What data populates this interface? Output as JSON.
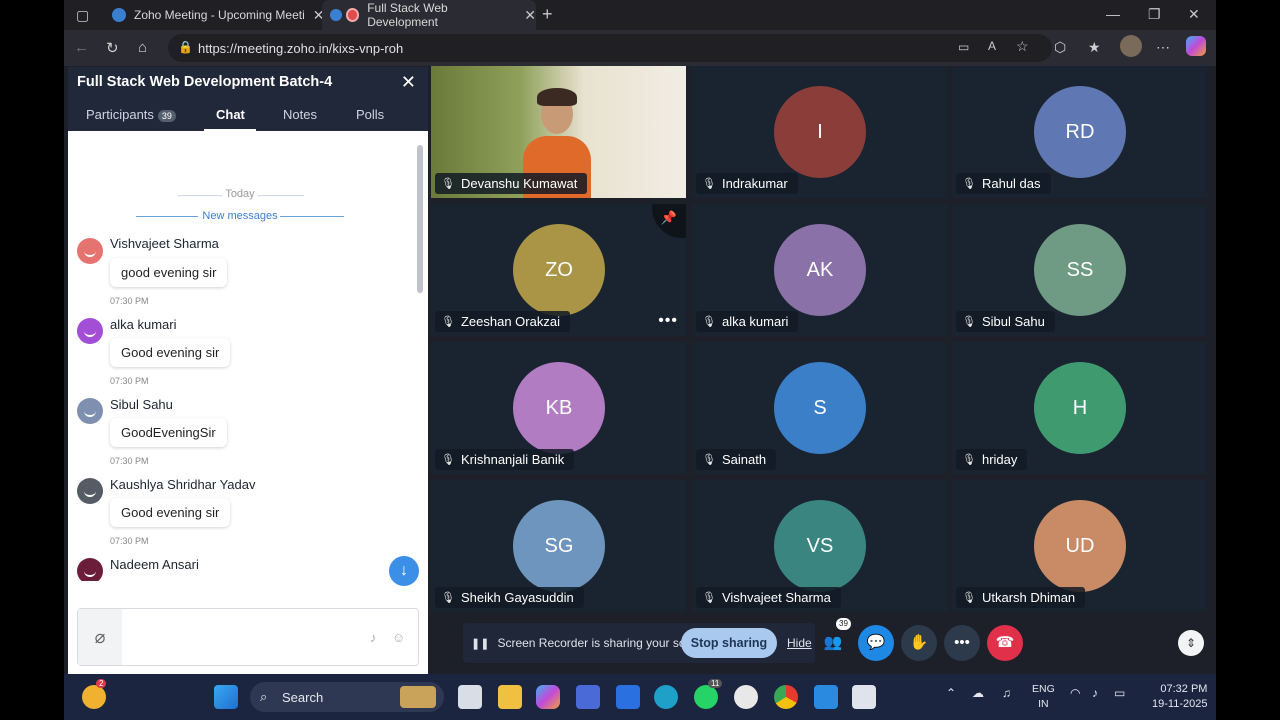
{
  "browser": {
    "tabs": [
      {
        "label": "Zoho Meeting - Upcoming Meeti"
      },
      {
        "label": "Full Stack Web Development"
      }
    ],
    "url": "https://meeting.zoho.in/kixs-vnp-roh"
  },
  "panel": {
    "title": "Full Stack Web Development Batch-4",
    "tabs": {
      "participants": "Participants",
      "participants_count": "39",
      "chat": "Chat",
      "notes": "Notes",
      "polls": "Polls"
    },
    "separator_today": "Today",
    "separator_new": "New messages",
    "messages": [
      {
        "name": "Vishvajeet Sharma",
        "text": "good evening sir",
        "time": "07:30 PM",
        "color": "#e5736f"
      },
      {
        "name": "alka kumari",
        "text": "Good evening sir",
        "time": "07:30 PM",
        "color": "#a24fd6"
      },
      {
        "name": "Sibul Sahu",
        "text": "GoodEveningSir",
        "time": "07:30 PM",
        "color": "#7f8fb0"
      },
      {
        "name": "Kaushlya Shridhar Yadav",
        "text": "Good evening sir",
        "time": "07:30 PM",
        "color": "#555c66"
      },
      {
        "name": "Nadeem Ansari",
        "color": "#6a1e3a"
      }
    ]
  },
  "grid": {
    "tiles": [
      {
        "name": "Devanshu Kumawat",
        "initials": "",
        "color": "#7c8a4a",
        "video": true
      },
      {
        "name": "Indrakumar",
        "initials": "I",
        "color": "#8a3d39"
      },
      {
        "name": "Rahul das",
        "initials": "RD",
        "color": "#5f78b3"
      },
      {
        "name": "Zeeshan Orakzai",
        "initials": "ZO",
        "color": "#a99545"
      },
      {
        "name": "alka kumari",
        "initials": "AK",
        "color": "#8a72a8"
      },
      {
        "name": "Sibul Sahu",
        "initials": "SS",
        "color": "#6f9a83"
      },
      {
        "name": "Krishnanjali Banik",
        "initials": "KB",
        "color": "#b27cc3"
      },
      {
        "name": "Sainath",
        "initials": "S",
        "color": "#3b7fc9"
      },
      {
        "name": "hriday",
        "initials": "H",
        "color": "#3f9a70"
      },
      {
        "name": "Sheikh Gayasuddin",
        "initials": "SG",
        "color": "#6e95bd"
      },
      {
        "name": "Vishvajeet Sharma",
        "initials": "VS",
        "color": "#3b8580"
      },
      {
        "name": "Utkarsh Dhiman",
        "initials": "UD",
        "color": "#c98a66"
      }
    ]
  },
  "controls": {
    "recorder_text": "Screen Recorder is sharing your screen.",
    "stop_sharing": "Stop sharing",
    "hide": "Hide",
    "participant_count": "39"
  },
  "taskbar": {
    "search": "Search",
    "lang_line1": "ENG",
    "lang_line2": "IN",
    "time": "07:32 PM",
    "date": "19-11-2025",
    "weather_badge": "2",
    "whatsapp_badge": "11"
  }
}
